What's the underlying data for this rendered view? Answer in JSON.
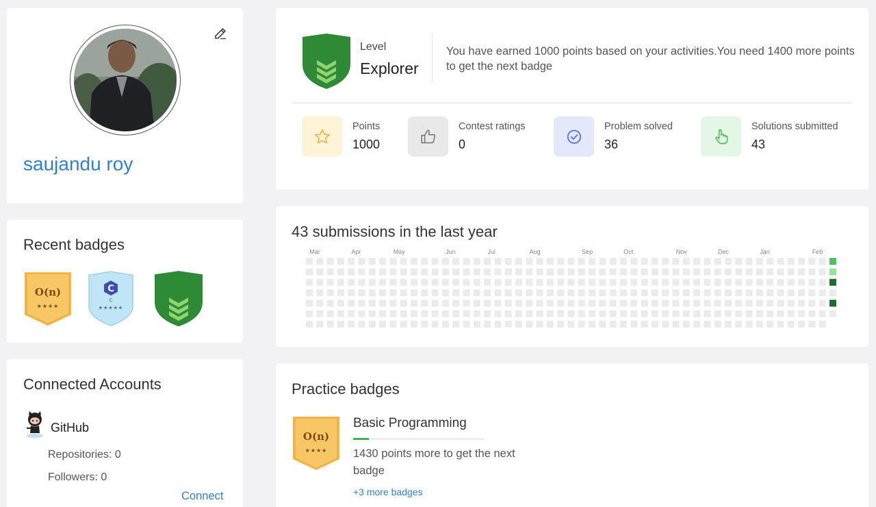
{
  "profile": {
    "name": "saujandu roy"
  },
  "recent_badges": {
    "title": "Recent badges",
    "badges": [
      {
        "name": "O(n)",
        "stars": "★★★★"
      },
      {
        "name": "C",
        "sub": "C",
        "stars": "★★★★★"
      },
      {
        "name": "Explorer"
      }
    ]
  },
  "accounts": {
    "title": "Connected Accounts",
    "provider": "GitHub",
    "repositories": "Repositories: 0",
    "followers": "Followers: 0",
    "connect_label": "Connect"
  },
  "level": {
    "label": "Level",
    "value": "Explorer",
    "description": "You have earned 1000 points based on your activities.You need 1400 more points to get the next badge"
  },
  "stats": [
    {
      "label": "Points",
      "value": "1000",
      "icon": "star-icon",
      "color": "#fdf3d6"
    },
    {
      "label": "Contest ratings",
      "value": "0",
      "icon": "thumbs-up-icon",
      "color": "#e9e9e9"
    },
    {
      "label": "Problem solved",
      "value": "36",
      "icon": "check-circle-icon",
      "color": "#e3e8fb"
    },
    {
      "label": "Solutions submitted",
      "value": "43",
      "icon": "pointer-hand-icon",
      "color": "#e4f6e6"
    }
  ],
  "submissions": {
    "title": "43 submissions in the last year",
    "months": [
      "Mar",
      "Apr",
      "May",
      "Jun",
      "Jul",
      "Aug",
      "Sep",
      "Oct",
      "Nov",
      "Dec",
      "Jan",
      "Feb"
    ],
    "active_cells": [
      {
        "week": 50,
        "day": 0,
        "level": 2
      },
      {
        "week": 50,
        "day": 1,
        "level": 1
      },
      {
        "week": 50,
        "day": 2,
        "level": 3
      },
      {
        "week": 50,
        "day": 4,
        "level": 3
      }
    ],
    "colors": {
      "empty": "#ebebeb",
      "l1": "#9be39b",
      "l2": "#4cc35a",
      "l3": "#1e6e2b"
    }
  },
  "practice": {
    "title": "Practice badges",
    "badge_name": "Basic Programming",
    "badge_symbol": "O(n)",
    "badge_stars": "★★★★",
    "progress": 0.12,
    "description": "1430 points more to get the next badge",
    "more_label": "+3 more badges"
  }
}
